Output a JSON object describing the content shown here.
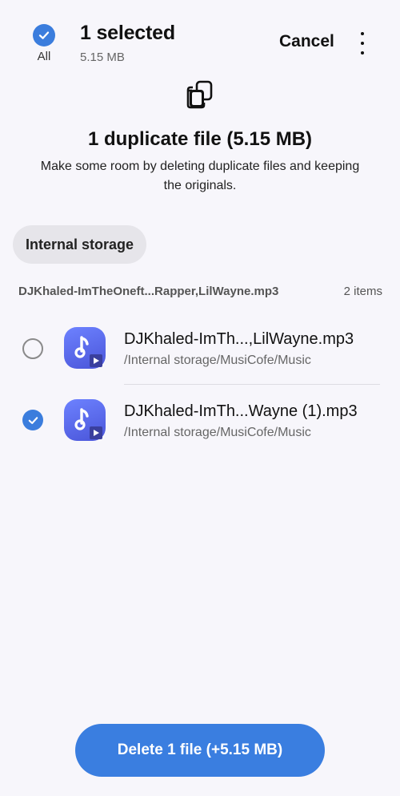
{
  "header": {
    "all_label": "All",
    "selected_title": "1 selected",
    "selected_size": "5.15 MB",
    "cancel_label": "Cancel",
    "more_icon": "more-vertical-icon"
  },
  "hero": {
    "icon": "duplicate-files-icon",
    "title": "1 duplicate file (5.15 MB)",
    "description": "Make some room by deleting duplicate files and keeping the originals."
  },
  "filter_chip": "Internal storage",
  "group": {
    "name": "DJKhaled-ImTheOneft...Rapper,LilWayne.mp3",
    "count": "2 items",
    "files": [
      {
        "name": "DJKhaled-ImTh...,LilWayne.mp3",
        "path": "/Internal storage/MusiCofe/Music",
        "selected": false,
        "icon": "music-file-icon"
      },
      {
        "name": "DJKhaled-ImTh...Wayne (1).mp3",
        "path": "/Internal storage/MusiCofe/Music",
        "selected": true,
        "icon": "music-file-icon"
      }
    ]
  },
  "footer": {
    "delete_label": "Delete 1 file (+5.15 MB)"
  },
  "colors": {
    "accent": "#3a7ee0",
    "background": "#f7f6fb",
    "chip_bg": "#e6e5ea",
    "music_icon": "#5a6cf0"
  }
}
